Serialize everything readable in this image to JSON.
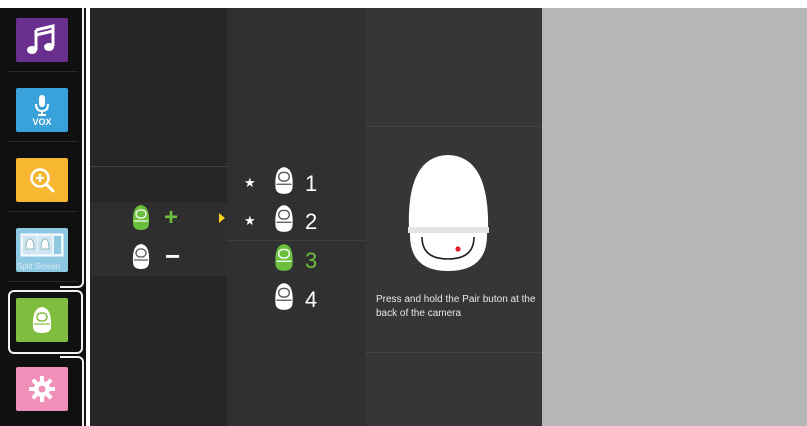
{
  "sidebar": {
    "items": [
      {
        "name": "music",
        "icon": "music-note-icon",
        "color": "#6a2e8e"
      },
      {
        "name": "vox",
        "icon": "microphone-icon",
        "label": "VOX",
        "color": "#3aa2db"
      },
      {
        "name": "zoom",
        "icon": "zoom-in-icon",
        "color": "#f7b731"
      },
      {
        "name": "split-screen",
        "icon": "split-screen-icon",
        "label": "Split Screen",
        "color": "#8ec8e3"
      },
      {
        "name": "camera",
        "icon": "camera-icon",
        "color": "#7fbd3f",
        "selected": true
      },
      {
        "name": "settings",
        "icon": "gear-icon",
        "color": "#f090b8"
      }
    ]
  },
  "camera_actions": {
    "add_symbol": "+",
    "remove_symbol": "−"
  },
  "camera_list": [
    {
      "number": "1",
      "starred": true,
      "active": false
    },
    {
      "number": "2",
      "starred": true,
      "active": false
    },
    {
      "number": "3",
      "starred": false,
      "active": true
    },
    {
      "number": "4",
      "starred": false,
      "active": false
    }
  ],
  "instructions": {
    "message": "Press and hold the Pair buton at the back of the camera"
  },
  "colors": {
    "accent_green": "#6cbf3c",
    "arrow_yellow": "#f4d21a",
    "pair_dot_red": "#e0202a"
  }
}
